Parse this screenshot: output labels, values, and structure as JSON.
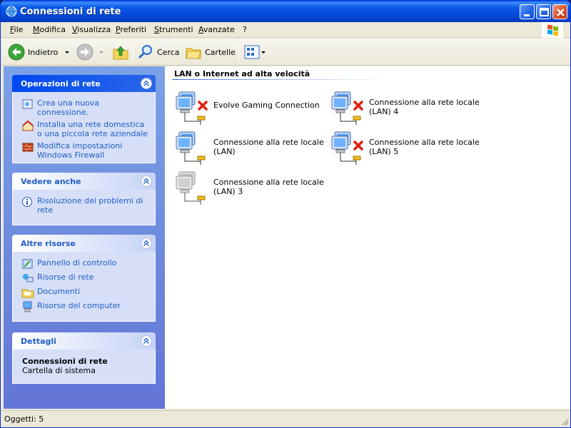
{
  "window": {
    "title": "Connessioni di rete"
  },
  "menu": [
    "File",
    "Modifica",
    "Visualizza",
    "Preferiti",
    "Strumenti",
    "Avanzate",
    "?"
  ],
  "toolbar": {
    "back": "Indietro",
    "search": "Cerca",
    "folders": "Cartelle"
  },
  "sidebar": {
    "network_tasks": {
      "title": "Operazioni di rete",
      "items": [
        "Crea una nuova connessione.",
        "Installa una rete domestica o una piccola rete aziendale",
        "Modifica impostazioni Windows Firewall"
      ]
    },
    "see_also": {
      "title": "Vedere anche",
      "items": [
        "Risoluzione dei problemi di rete"
      ]
    },
    "other_places": {
      "title": "Altre risorse",
      "items": [
        "Pannello di controllo",
        "Risorse di rete",
        "Documenti",
        "Risorse del computer"
      ]
    },
    "details": {
      "title": "Dettagli",
      "name": "Connessioni di rete",
      "type": "Cartella di sistema"
    }
  },
  "content": {
    "group_title": "LAN o Internet ad alta velocità",
    "connections": [
      {
        "name": "Evolve Gaming Connection",
        "status": "disconnected"
      },
      {
        "name": "Connessione alla rete locale (LAN) 4",
        "status": "disconnected"
      },
      {
        "name": "Connessione alla rete locale (LAN)",
        "status": "connected"
      },
      {
        "name": "Connessione alla rete locale (LAN) 5",
        "status": "disconnected"
      },
      {
        "name": "Connessione alla rete locale (LAN) 3",
        "status": "disabled"
      }
    ]
  },
  "status": {
    "objects": "Oggetti: 5"
  },
  "colors": {
    "titlebar": "#0a5ae8",
    "link": "#215dc6",
    "panel_body": "#d6dff7",
    "sidebar": "#7ba2e7"
  }
}
